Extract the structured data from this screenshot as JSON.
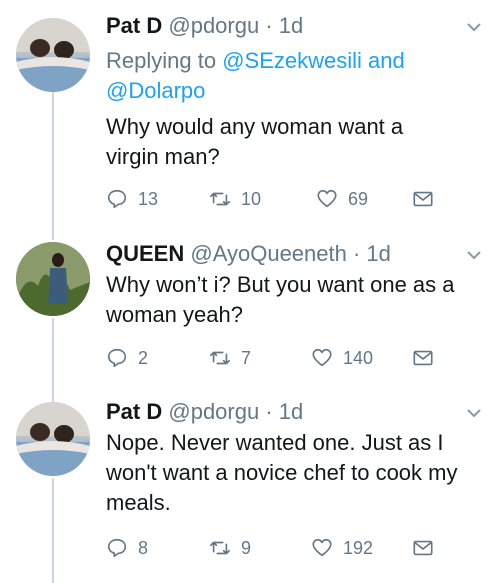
{
  "tweets": [
    {
      "name": "Pat D",
      "handle": "@pdorgu",
      "sep": " · ",
      "time": "1d",
      "replying_prefix": "Replying to ",
      "reply_mention_1": "@SEzekwesili",
      "reply_and": " and",
      "reply_mention_2": "@Dolarpo",
      "text": "Why would any woman want a virgin man?",
      "replies": "13",
      "retweets": "10",
      "likes": "69"
    },
    {
      "name": "QUEEN",
      "handle": "@AyoQueeneth",
      "sep": " · ",
      "time": "1d",
      "text": "Why won’t i? But you want one as a woman yeah?",
      "replies": "2",
      "retweets": "7",
      "likes": "140"
    },
    {
      "name": "Pat D",
      "handle": "@pdorgu",
      "sep": " · ",
      "time": "1d",
      "text": "Nope. Never wanted one. Just as I won't want a novice chef to cook my meals.",
      "replies": "8",
      "retweets": "9",
      "likes": "192"
    }
  ],
  "icons": {
    "reply": "reply-icon",
    "retweet": "retweet-icon",
    "like": "heart-icon",
    "dm": "envelope-icon",
    "menu": "chevron-down-icon"
  },
  "colors": {
    "link": "#1da1f2",
    "muted": "#657786",
    "text": "#14171a",
    "thread_line": "#cdd6dd"
  }
}
